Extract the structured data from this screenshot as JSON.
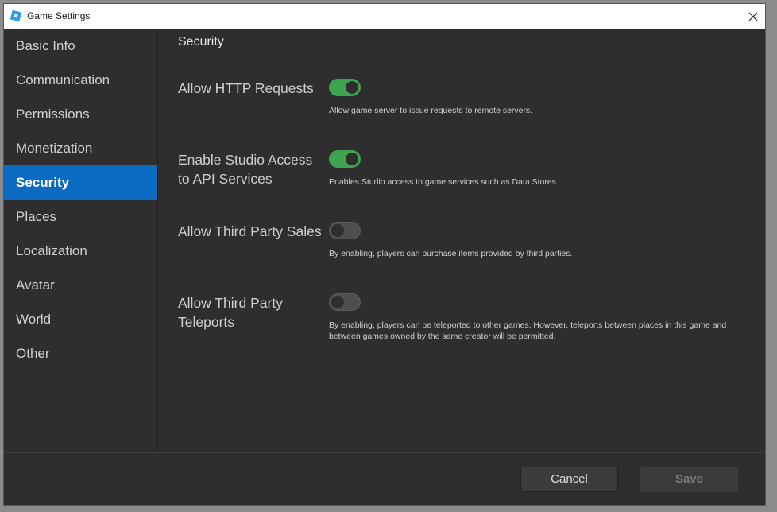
{
  "window": {
    "title": "Game Settings",
    "icon": "roblox-studio-icon",
    "close_icon": "close-icon"
  },
  "sidebar": {
    "items": [
      {
        "label": "Basic Info",
        "active": false
      },
      {
        "label": "Communication",
        "active": false
      },
      {
        "label": "Permissions",
        "active": false
      },
      {
        "label": "Monetization",
        "active": false
      },
      {
        "label": "Security",
        "active": true
      },
      {
        "label": "Places",
        "active": false
      },
      {
        "label": "Localization",
        "active": false
      },
      {
        "label": "Avatar",
        "active": false
      },
      {
        "label": "World",
        "active": false
      },
      {
        "label": "Other",
        "active": false
      }
    ]
  },
  "main": {
    "section_title": "Security",
    "settings": [
      {
        "label": "Allow HTTP Requests",
        "enabled": true,
        "description": "Allow game server to issue requests to remote servers."
      },
      {
        "label": "Enable Studio Access to API Services",
        "enabled": true,
        "description": "Enables Studio access to game services such as Data Stores"
      },
      {
        "label": "Allow Third Party Sales",
        "enabled": false,
        "description": "By enabling, players can purchase items provided by third parties."
      },
      {
        "label": "Allow Third Party Teleports",
        "enabled": false,
        "description": "By enabling, players can be teleported to other games. However, teleports between places in this game and between games owned by the same creator will be permitted."
      }
    ]
  },
  "footer": {
    "cancel_label": "Cancel",
    "save_label": "Save"
  },
  "colors": {
    "accent": "#0b6ac1",
    "toggle_on": "#3fa452",
    "background": "#2e2e2e"
  }
}
